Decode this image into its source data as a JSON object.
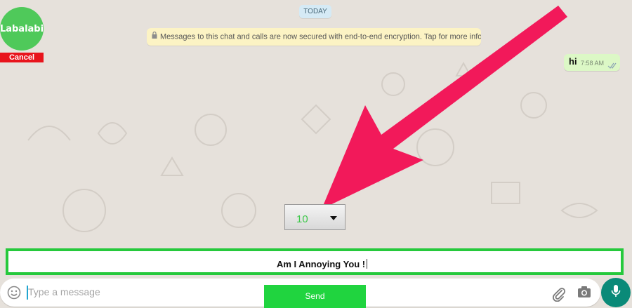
{
  "contact": {
    "name": "Labalabi",
    "cancel_label": "Cancel"
  },
  "chat": {
    "date_label": "TODAY",
    "encryption_notice": "Messages to this chat and calls are now secured with end-to-end encryption. Tap for more info.",
    "messages": [
      {
        "text": "hi",
        "time": "7:58 AM",
        "status": "read"
      }
    ]
  },
  "spam_tool": {
    "count_value": "10",
    "message_value": "Am I Annoying You !",
    "send_label": "Send"
  },
  "composer": {
    "placeholder": "Type a message"
  },
  "icons": [
    "emoji-icon",
    "attach-icon",
    "camera-icon",
    "mic-icon",
    "lock-icon",
    "double-check-icon",
    "chevron-down-icon"
  ],
  "colors": {
    "background": "#e6e1db",
    "bubble_out": "#dcf8c6",
    "notice": "#fcf3c4",
    "accent_green": "#26c93c",
    "cancel_red": "#e8141c",
    "annotation_arrow": "#f2195a",
    "mic_teal": "#0a8a78"
  }
}
